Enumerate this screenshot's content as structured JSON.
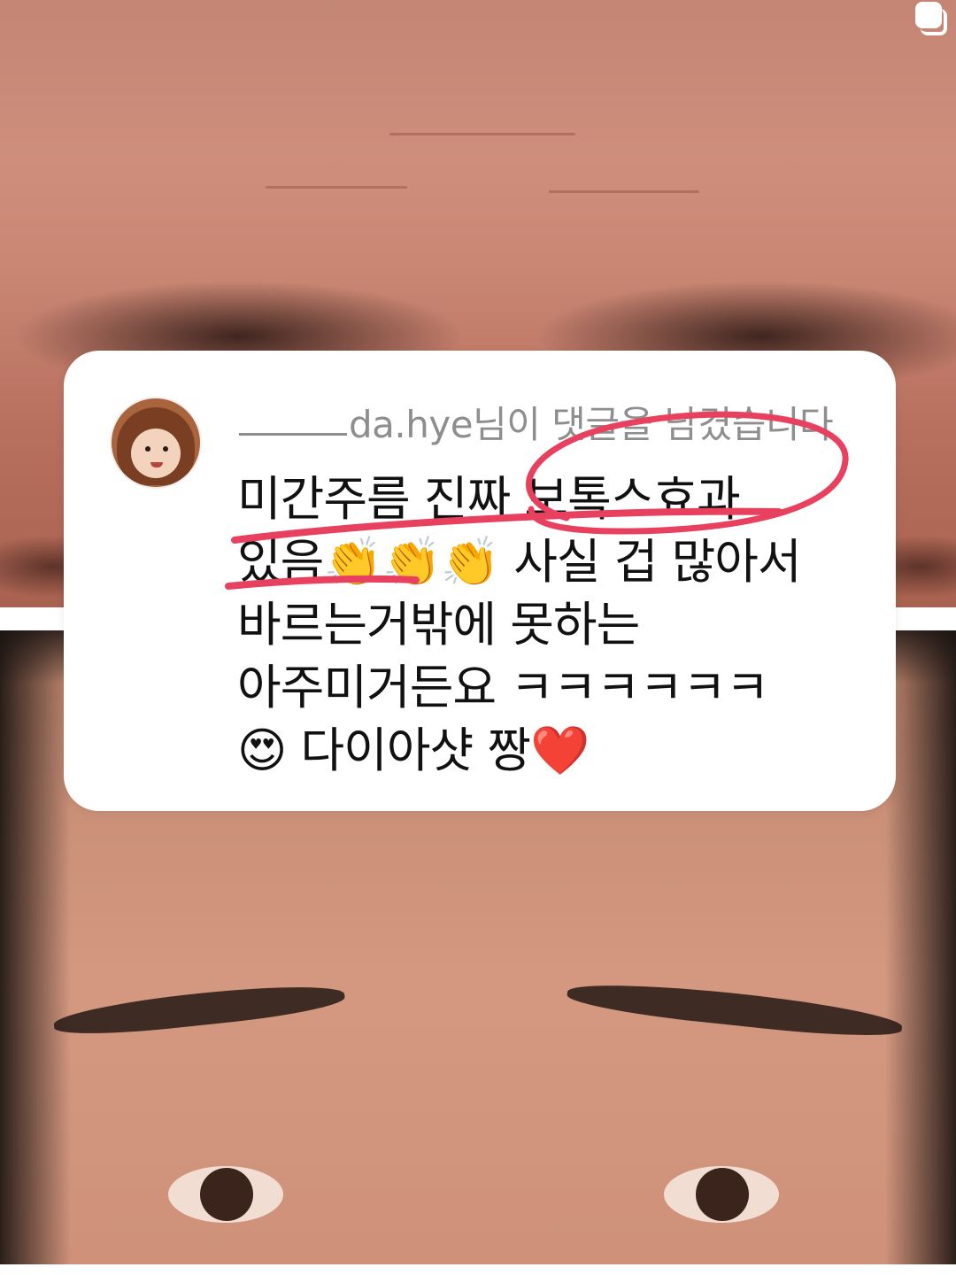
{
  "story": {
    "comment_card": {
      "header": {
        "username": "da.hye",
        "suffix": "님이 댓글을 남겼습니다"
      },
      "comment_lines": [
        "미간주름 진짜 보톡스효과",
        "있음👏👏👏 사실 겁 많아서",
        "바르는거밖에 못하는",
        "아주미거든요 ㅋㅋㅋㅋㅋㅋ",
        "😍 다이아샷 짱❤️"
      ]
    },
    "annotation_color": "#e8415f",
    "icons": {
      "corner": "sticker-icon",
      "avatar": "profile-avatar"
    }
  }
}
